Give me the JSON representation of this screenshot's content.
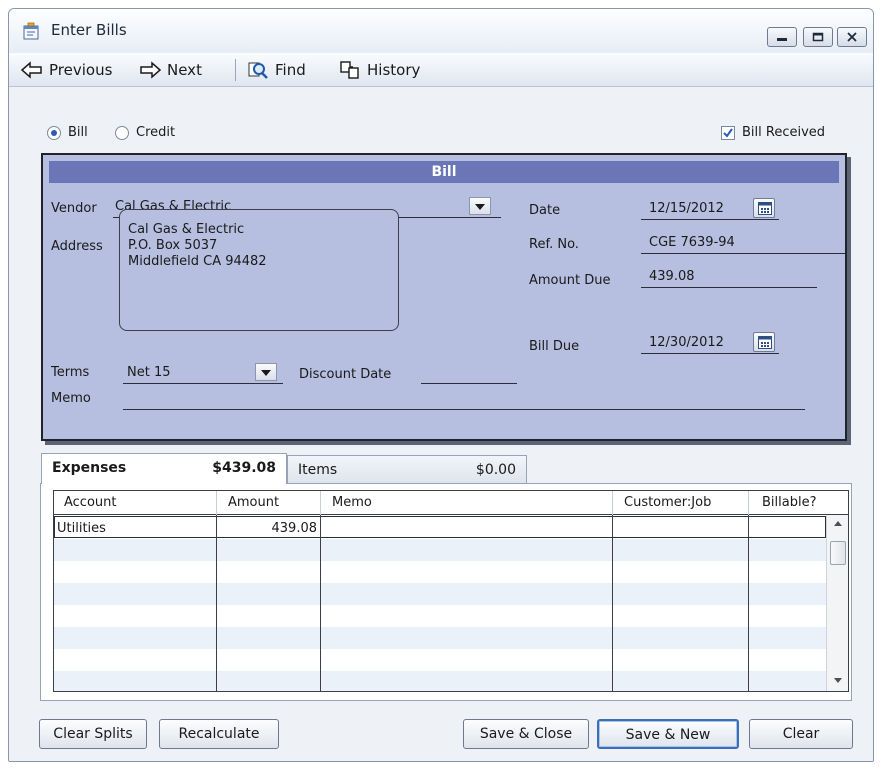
{
  "window": {
    "title": "Enter Bills",
    "controls": [
      "minimize",
      "maximize",
      "close"
    ]
  },
  "toolbar": {
    "previous": "Previous",
    "next": "Next",
    "find": "Find",
    "history": "History"
  },
  "mode": {
    "bill_label": "Bill",
    "credit_label": "Credit",
    "selected": "Bill",
    "bill_received_label": "Bill Received",
    "bill_received_checked": true
  },
  "bill": {
    "header": "Bill",
    "vendor_label": "Vendor",
    "vendor_value": "Cal Gas & Electric",
    "address_label": "Address",
    "address_lines": [
      "Cal Gas & Electric",
      "P.O. Box 5037",
      "Middlefield CA 94482"
    ],
    "terms_label": "Terms",
    "terms_value": "Net 15",
    "discount_date_label": "Discount Date",
    "discount_date_value": "",
    "memo_label": "Memo",
    "memo_value": "",
    "date_label": "Date",
    "date_value": "12/15/2012",
    "ref_label": "Ref. No.",
    "ref_value": "CGE 7639-94",
    "amount_due_label": "Amount Due",
    "amount_due_value": "439.08",
    "bill_due_label": "Bill Due",
    "bill_due_value": "12/30/2012"
  },
  "tabs": [
    {
      "label": "Expenses",
      "amount": "$439.08",
      "active": true
    },
    {
      "label": "Items",
      "amount": "$0.00",
      "active": false
    }
  ],
  "grid": {
    "columns": [
      "Account",
      "Amount",
      "Memo",
      "Customer:Job",
      "Billable?"
    ],
    "rows": [
      {
        "account": "Utilities",
        "amount": "439.08",
        "memo": "",
        "customer_job": "",
        "billable": ""
      }
    ]
  },
  "footer": {
    "clear_splits": "Clear Splits",
    "recalculate": "Recalculate",
    "save_close": "Save & Close",
    "save_new": "Save & New",
    "clear": "Clear"
  }
}
